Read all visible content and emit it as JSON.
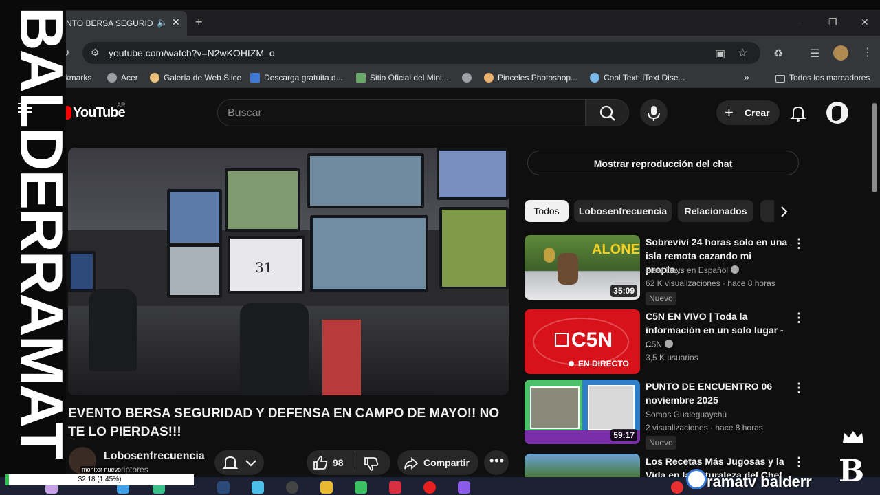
{
  "browser": {
    "tab_title": "EVENTO BERSA SEGURIDAD Y",
    "url": "youtube.com/watch?v=N2wKOHIZM_o",
    "bookmarks": [
      {
        "label": "okmarks"
      },
      {
        "label": "Acer"
      },
      {
        "label": "Galería de Web Slice"
      },
      {
        "label": "Descarga gratuita d..."
      },
      {
        "label": "Sitio Oficial del Mini..."
      },
      {
        "label": ""
      },
      {
        "label": "Pinceles Photoshop..."
      },
      {
        "label": "Cool Text: iText Dise..."
      }
    ],
    "all_bookmarks": "Todos los marcadores",
    "overflow": "»"
  },
  "youtube": {
    "logo": "YouTube",
    "country": "AR",
    "search_placeholder": "Buscar",
    "create_label": "Crear"
  },
  "video": {
    "title": "EVENTO BERSA SEGURIDAD Y DEFENSA EN CAMPO DE MAYO!! NO TE LO PIERDAS!!!",
    "channel": "Lobosenfrecuencia",
    "subscribers": "suscriptores",
    "likes": "98",
    "share_label": "Compartir",
    "monitor_text": "31"
  },
  "sidebar": {
    "chat_button": "Mostrar reproducción del chat",
    "chips": [
      "Todos",
      "Lobosenfrecuencia",
      "Relacionados"
    ],
    "items": [
      {
        "title": "Sobreviví 24 horas solo en una isla remota cazando mi propia...",
        "channel": "Field Days en Español",
        "meta": "62 K visualizaciones · hace 8 horas",
        "badge": "Nuevo",
        "duration": "35:09",
        "thumb_text": "ALONE"
      },
      {
        "title": "C5N EN VIVO | Toda la información en un solo lugar - ...",
        "channel": "C5N",
        "meta": "3,5 K usuarios",
        "badge": "",
        "duration": "",
        "thumb_text": "C5N",
        "thumb_sub": "EN DIRECTO"
      },
      {
        "title": "PUNTO DE ENCUENTRO   06 noviembre 2025",
        "channel": "Somos Gualeguaychú",
        "meta": "2 visualizaciones · hace 8 horas",
        "badge": "Nuevo",
        "duration": "59:17",
        "thumb_text": ""
      },
      {
        "title": "Los Recetas Más Jugosas y la Vida en la Naturaleza del Chef",
        "channel": "",
        "meta": "",
        "badge": "",
        "duration": "",
        "thumb_text": ""
      }
    ]
  },
  "overlay": {
    "vertical_text": "BALDERRAMAT",
    "stat_text": "$2.18 (1.45%)",
    "monitor_label": "monitor nuevo",
    "brand_right": "ramatv  balderr",
    "big_letter": "B"
  },
  "colors": {
    "youtube_red": "#ff0000",
    "background": "#0f0f0f",
    "c5n_red": "#d8121b"
  }
}
